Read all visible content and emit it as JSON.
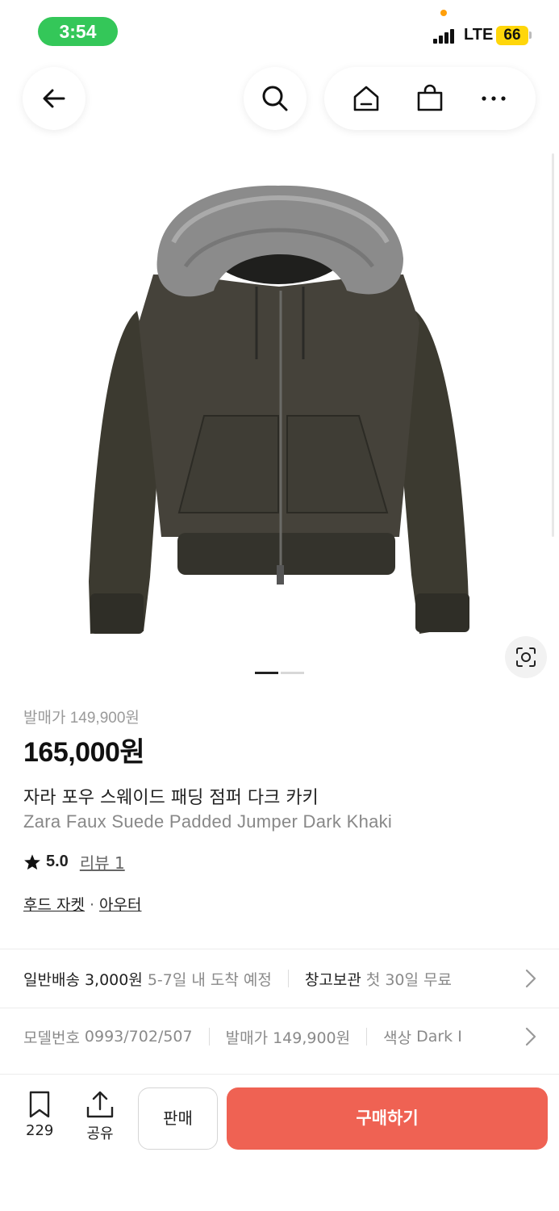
{
  "status_bar": {
    "time": "3:54",
    "network": "LTE",
    "battery": "66"
  },
  "nav": {
    "icons": [
      "back-arrow-icon",
      "search-icon",
      "home-icon",
      "shopping-bag-icon",
      "more-icon"
    ]
  },
  "gallery": {
    "image": "khaki hooded jumper with grey fur trim",
    "page_index": 1,
    "page_count": 2
  },
  "product": {
    "release_price": "발매가 149,900원",
    "price": "165,000원",
    "name_ko": "자라 포우 스웨이드 패딩 점퍼 다크 카키",
    "name_en": "Zara Faux Suede Padded Jumper Dark Khaki",
    "rating": "5.0",
    "review_link": "리뷰 1",
    "tags": [
      "후드 자켓",
      "아우터"
    ]
  },
  "shipping": {
    "label": "일반배송 3,000원",
    "eta": "5-7일 내 도착 예정",
    "storage_label": "창고보관",
    "storage_note": "첫 30일 무료"
  },
  "info": {
    "model_label": "모델번호",
    "model_value": "0993/702/507",
    "release_label": "발매가",
    "release_value": "149,900원",
    "color_label": "색상",
    "color_value": "Dark I"
  },
  "bottom_bar": {
    "wish_count": "229",
    "share_label": "공유",
    "sell_label": "판매",
    "buy_label": "구매하기"
  },
  "colors": {
    "accent": "#ef6253",
    "status_time": "#34c759",
    "battery": "#ffd60a"
  }
}
